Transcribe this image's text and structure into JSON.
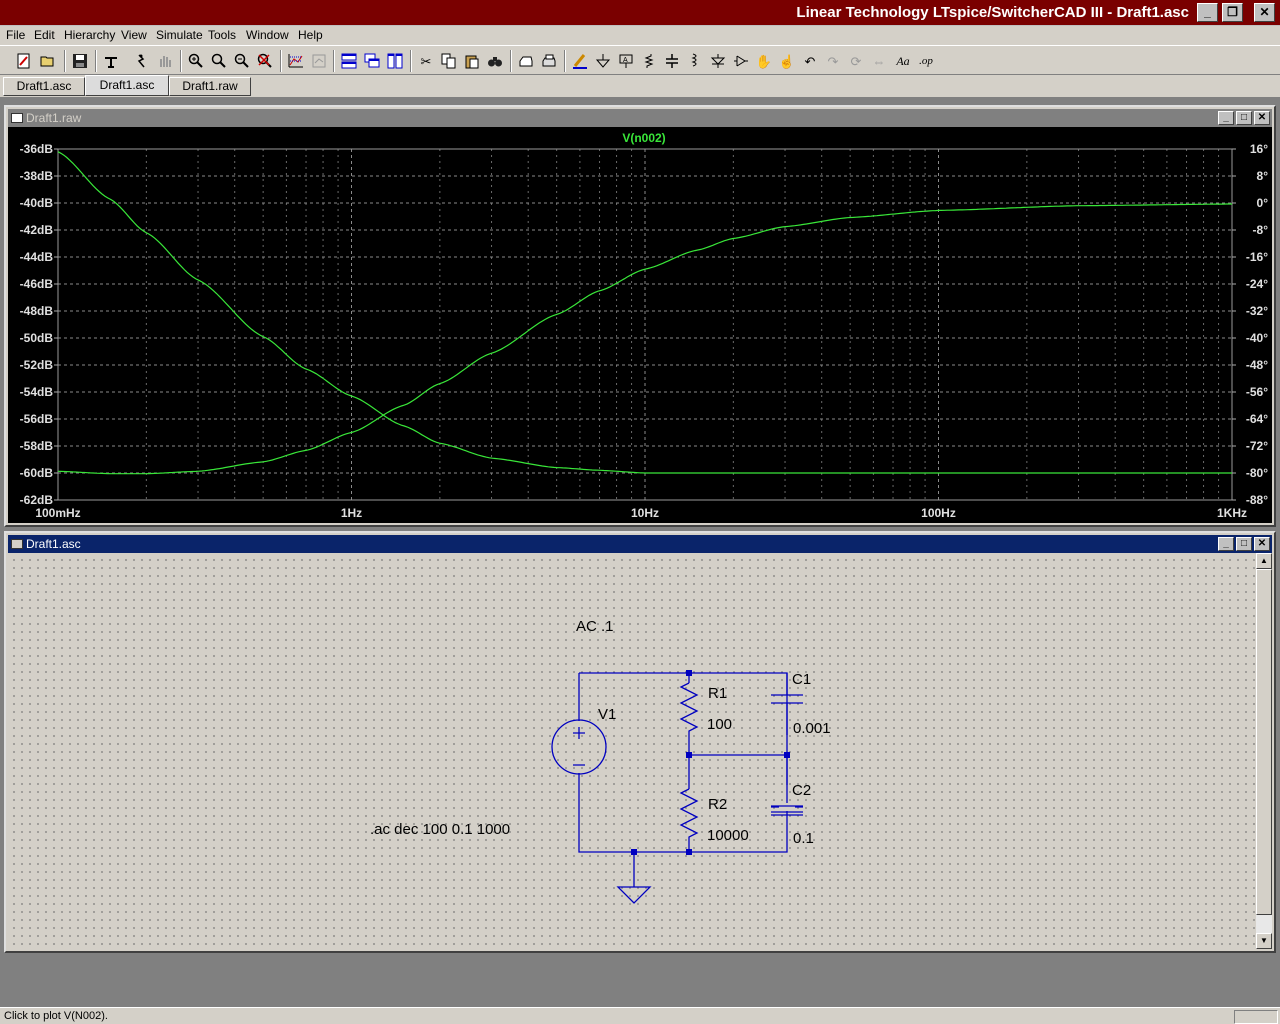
{
  "window": {
    "title": "Linear Technology LTspice/SwitcherCAD III - Draft1.asc"
  },
  "menu": [
    "File",
    "Edit",
    "Hierarchy",
    "View",
    "Simulate",
    "Tools",
    "Window",
    "Help"
  ],
  "tabs": [
    {
      "label": "Draft1.asc",
      "active": false
    },
    {
      "label": "Draft1.asc",
      "active": true
    },
    {
      "label": "Draft1.raw",
      "active": false
    }
  ],
  "toolbar_icons": [
    "new-schematic-icon",
    "open-icon",
    "save-icon",
    "control-panel-icon",
    "run-icon",
    "halt-icon",
    "zoom-in-icon",
    "zoom-pan-icon",
    "zoom-out-icon",
    "zoom-full-icon",
    "autorange-icon",
    "delete-trace-icon",
    "tile-vertical-icon",
    "cascade-icon",
    "tile-horizontal-icon",
    "cut-icon",
    "copy-icon",
    "paste-icon",
    "find-icon",
    "print-setup-icon",
    "print-icon",
    "draw-wire-icon",
    "ground-icon",
    "label-net-icon",
    "resistor-icon",
    "capacitor-icon",
    "inductor-icon",
    "diode-icon",
    "component-icon",
    "move-icon",
    "drag-icon",
    "undo-icon",
    "redo-icon",
    "rotate-icon",
    "mirror-icon",
    "text-icon",
    "spice-directive-icon"
  ],
  "plot_window": {
    "title": "Draft1.raw",
    "trace_label": "V(n002)",
    "trace_color": "#39e639"
  },
  "schematic_window": {
    "title": "Draft1.asc",
    "labels": {
      "source_value": "AC .1",
      "v1": "V1",
      "r1": "R1",
      "r1_value": "100",
      "r2": "R2",
      "r2_value": "10000",
      "c1": "C1",
      "c1_value": "0.001",
      "c2": "C2",
      "c2_value": "0.1",
      "directive": ".ac dec 100 0.1 1000"
    },
    "wire_color": "#0000c0"
  },
  "status": {
    "text": "Click to plot V(N002)."
  },
  "chart_data": {
    "type": "line",
    "title": "V(n002)",
    "x_scale": "log",
    "x_ticks": [
      "100mHz",
      "1Hz",
      "10Hz",
      "100Hz",
      "1KHz"
    ],
    "xlim": [
      0.1,
      1000
    ],
    "y_left_ticks": [
      "-36dB",
      "-38dB",
      "-40dB",
      "-42dB",
      "-44dB",
      "-46dB",
      "-48dB",
      "-50dB",
      "-52dB",
      "-54dB",
      "-56dB",
      "-58dB",
      "-60dB",
      "-62dB"
    ],
    "y_left_lim": [
      -62,
      -36
    ],
    "y_right_ticks": [
      "16°",
      "8°",
      "0°",
      "-8°",
      "-16°",
      "-24°",
      "-32°",
      "-40°",
      "-48°",
      "-56°",
      "-64°",
      "-72°",
      "-80°",
      "-88°"
    ],
    "y_right_lim": [
      -88,
      16
    ],
    "grid": true,
    "series": [
      {
        "axis": "left",
        "x": [
          0.1,
          0.15,
          0.2,
          0.3,
          0.5,
          0.7,
          1.0,
          1.5,
          2.0,
          3.0,
          5.0,
          7.0,
          10,
          20,
          50,
          100,
          300,
          1000
        ],
        "y": [
          -36.2,
          -39.7,
          -42.2,
          -45.7,
          -49.9,
          -52.3,
          -54.3,
          -56.5,
          -57.8,
          -58.9,
          -59.6,
          -59.8,
          -60.0,
          -60.0,
          -60.0,
          -60.0,
          -60.0,
          -60.0
        ]
      },
      {
        "axis": "right",
        "x": [
          0.1,
          0.15,
          0.2,
          0.3,
          0.5,
          0.7,
          1.0,
          1.5,
          2.0,
          3.0,
          5.0,
          7.0,
          10,
          15,
          20,
          30,
          50,
          100,
          300,
          1000
        ],
        "y": [
          -79.5,
          -80.2,
          -80.2,
          -79.5,
          -76.7,
          -73.3,
          -68.0,
          -60.0,
          -53.5,
          -44.5,
          -33.0,
          -26.0,
          -19.6,
          -14.0,
          -10.5,
          -7.0,
          -4.3,
          -2.2,
          -0.8,
          -0.3
        ]
      }
    ]
  }
}
